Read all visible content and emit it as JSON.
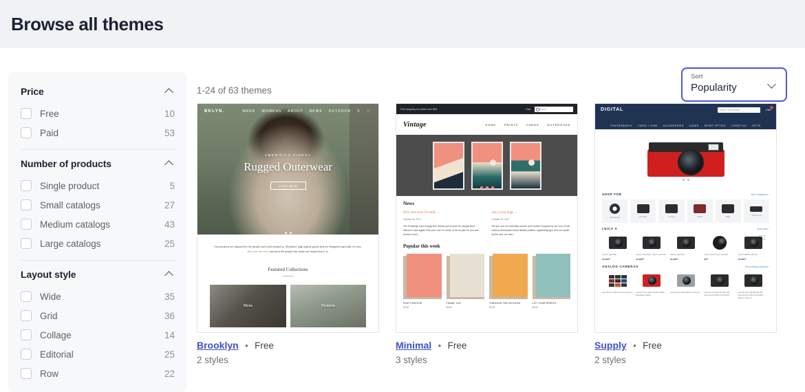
{
  "header": {
    "title": "Browse all themes"
  },
  "sidebar": {
    "groups": [
      {
        "title": "Price",
        "chevron": "chevron-up-icon",
        "options": [
          {
            "label": "Free",
            "count": "10"
          },
          {
            "label": "Paid",
            "count": "53"
          }
        ]
      },
      {
        "title": "Number of products",
        "chevron": "chevron-up-icon",
        "options": [
          {
            "label": "Single product",
            "count": "5"
          },
          {
            "label": "Small catalogs",
            "count": "27"
          },
          {
            "label": "Medium catalogs",
            "count": "43"
          },
          {
            "label": "Large catalogs",
            "count": "25"
          }
        ]
      },
      {
        "title": "Layout style",
        "chevron": "chevron-up-icon",
        "options": [
          {
            "label": "Wide",
            "count": "35"
          },
          {
            "label": "Grid",
            "count": "36"
          },
          {
            "label": "Collage",
            "count": "14"
          },
          {
            "label": "Editorial",
            "count": "25"
          },
          {
            "label": "Row",
            "count": "22"
          }
        ]
      }
    ]
  },
  "main": {
    "result_count": "1-24 of 63 themes",
    "sort": {
      "caption": "Sort",
      "value": "Popularity",
      "chevron": "chevron-down-icon",
      "border_color": "#4b56d2"
    },
    "themes": [
      {
        "name": "Brooklyn",
        "separator": "•",
        "price": "Free",
        "styles": "2 styles"
      },
      {
        "name": "Minimal",
        "separator": "•",
        "price": "Free",
        "styles": "3 styles"
      },
      {
        "name": "Supply",
        "separator": "•",
        "price": "Free",
        "styles": "2 styles"
      }
    ]
  },
  "previews": {
    "brooklyn": {
      "logo": "BKLYN.",
      "nav": [
        "MENS",
        "WOMENS",
        "ABOUT",
        "NEWS",
        "OUTDOOR"
      ],
      "eyebrow": "AMERICA'S FINEST",
      "headline": "Rugged Outerwear",
      "cta": "SHOP NOW",
      "intro": "Our products are inspired by the people and world around us. Beautiful, high quality goods that are designed especially for you.",
      "intro_link": "Discover our story",
      "intro_tail": "and meet the people that make our brand what it is.",
      "featured_title": "Featured Collections",
      "tiles": [
        "Mens",
        "Womens"
      ]
    },
    "minimal": {
      "promo": "Free shipping on orders over $50",
      "cart": "Cart",
      "search_placeholder": "Search",
      "logo": "Vintage",
      "nav": [
        "HOME",
        "PRINTS",
        "CARDS",
        "NOTEBOOKS"
      ],
      "news_title": "News",
      "news": [
        {
          "title": "Pick your own 10 cards →",
          "date": "October 16, 2017",
          "body": "Our Greetings Card Supply Box means you'll never be caught short without a card again! Pick your own 10 cards, or let us pick for you and receive a box..."
        },
        {
          "title": "Get ya hot dogs →",
          "date": "October 16, 2017",
          "body": "Did you see our new fably screen print series? Inspired by our love of mid century Americana movie theatre posters, signwriting type and our studio by the sea, our new..."
        }
      ],
      "popular_title": "Popular this week",
      "products": [
        {
          "name": "STAY POSITIVE",
          "price": "$3.50"
        },
        {
          "name": "THANK YOU",
          "price": "$3.50"
        },
        {
          "name": "THROUGH THE KEYHOLE",
          "price": "$3.50"
        },
        {
          "name": "LIFT YOUR SPIRITS",
          "price": "$3.50"
        }
      ]
    },
    "supply": {
      "logo": "DIGITAL",
      "search_placeholder": "Search all products...",
      "cart": "Cart",
      "nav": [
        "PHOTOGRAPHY",
        "VIDEO + CINE",
        "ACCESSORIES",
        "CASES",
        "SPORT OPTICS",
        "LIFESTYLE",
        "GIFTS"
      ],
      "sections": [
        {
          "title": "SHOP FOR",
          "link": "More categories ›"
        },
        {
          "title": "LEICA S",
          "link": "More leica ›"
        },
        {
          "title": "ANALOG CAMERAS",
          "link": "More analog cameras ›"
        }
      ],
      "shop_for": [
        "Accessories",
        "Cameras",
        "Lenses",
        "Cases",
        "Bags",
        "Thumbs Up"
      ],
      "leica_products": [
        {
          "name": "Leica S (Typ 006)",
          "price": "21,950⁰⁰"
        },
        {
          "name": "Leica S (Typ 006) + 70mm Leica Set",
          "price": "25,200⁰⁰"
        },
        {
          "name": "Leica S (Typ 007)",
          "price": "16,500⁰⁰"
        },
        {
          "name": "Leica S and S-Lens Cap 030",
          "price": "60⁰⁰"
        },
        {
          "name": "Leica S-Edition 100 Set",
          "price": "34,500⁰⁰"
        }
      ],
      "analog_products": [
        {
          "name": "Leica M (Typ 240) a la carte Program"
        },
        {
          "name": "Leica M (Typ 240) a la carte, Black Body/Red Leather"
        },
        {
          "name": "Leica M (Typ 240) 240mm 'Leica Kit'"
        },
        {
          "name": "Leica SL (Typ 601) Bundle with Summicron-M 35mm f/2 ASPH"
        },
        {
          "name": "Leica M (Typ 262) Bundle with Summicron-M 35mm f/2 ASPH, Battery, Case Kit"
        }
      ]
    }
  }
}
